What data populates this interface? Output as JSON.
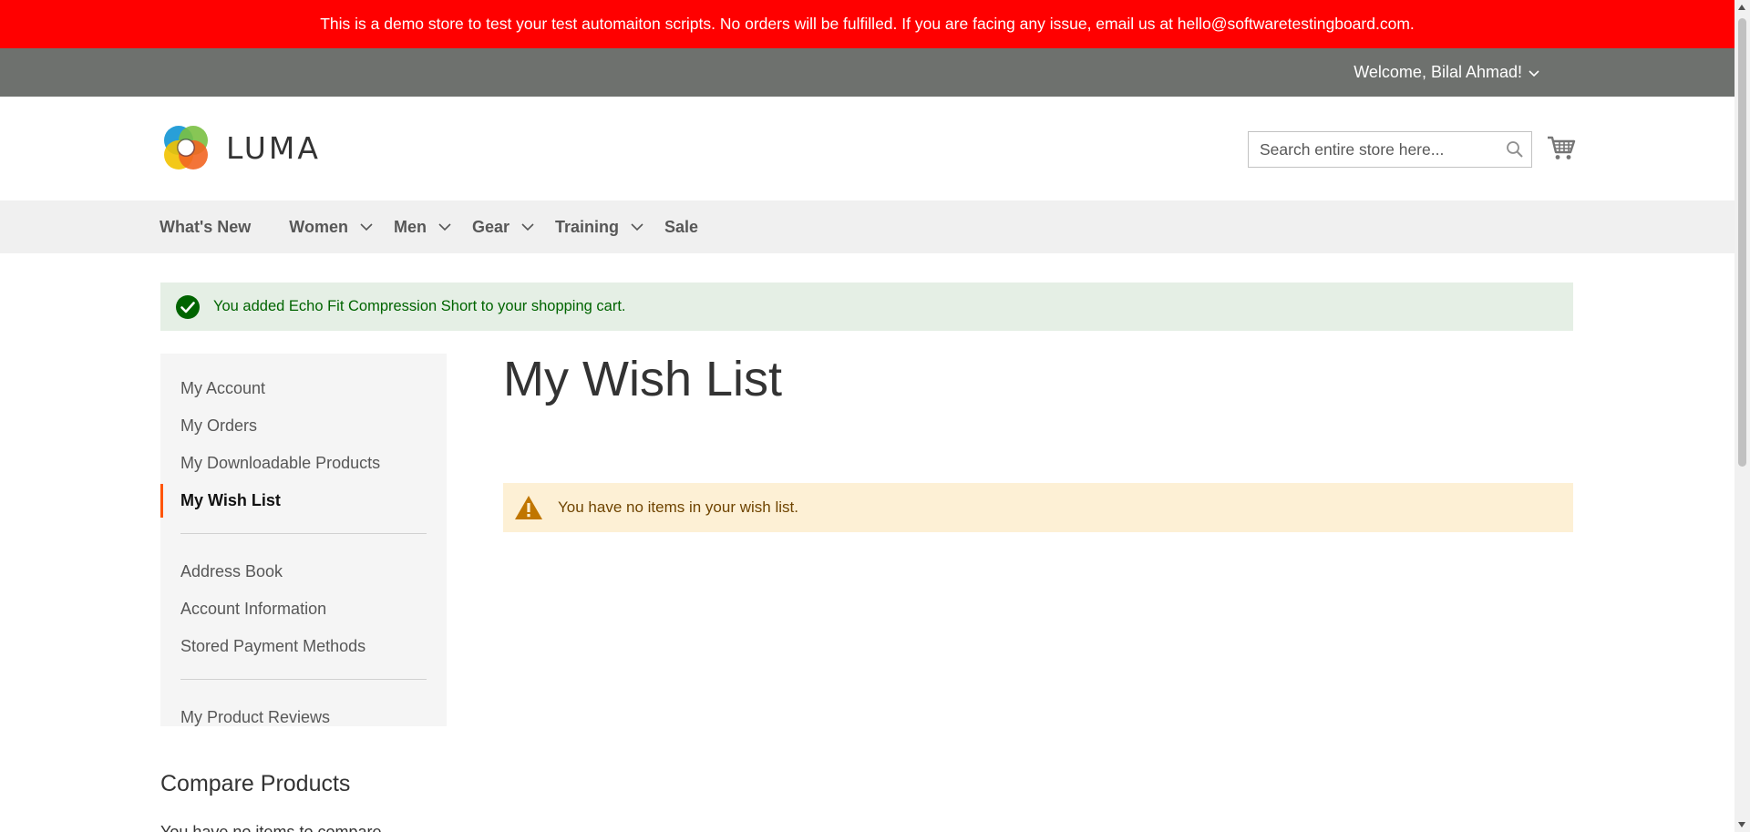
{
  "banner": {
    "text": "This is a demo store to test your test automaiton scripts. No orders will be fulfilled. If you are facing any issue, email us at hello@softwaretestingboard.com."
  },
  "header": {
    "welcome": "Welcome, Bilal Ahmad!",
    "logo_text": "LUMA",
    "search_placeholder": "Search entire store here...",
    "icons": {
      "search": "search-icon",
      "cart": "cart-icon",
      "account_toggle": "chevron-down-icon"
    }
  },
  "nav": {
    "items": [
      {
        "label": "What's New",
        "has_submenu": false
      },
      {
        "label": "Women",
        "has_submenu": true
      },
      {
        "label": "Men",
        "has_submenu": true
      },
      {
        "label": "Gear",
        "has_submenu": true
      },
      {
        "label": "Training",
        "has_submenu": true
      },
      {
        "label": "Sale",
        "has_submenu": false
      }
    ]
  },
  "messages": {
    "success": "You added Echo Fit Compression Short to your shopping cart.",
    "warning": "You have no items in your wish list."
  },
  "sidebar": {
    "group1": [
      "My Account",
      "My Orders",
      "My Downloadable Products",
      "My Wish List"
    ],
    "current": "My Wish List",
    "group2": [
      "Address Book",
      "Account Information",
      "Stored Payment Methods"
    ],
    "group3": [
      "My Product Reviews"
    ]
  },
  "main": {
    "title": "My Wish List"
  },
  "compare": {
    "title": "Compare Products",
    "empty_text": "You have no items to compare."
  },
  "colors": {
    "banner_bg": "#ff0000",
    "header_bar_bg": "#6e716e",
    "nav_bg": "#f0f0f0",
    "success_bg": "#e5efe5",
    "success_text": "#006400",
    "warning_bg": "#fdf0d5",
    "warning_icon": "#c07600",
    "current_marker": "#ff5501"
  }
}
